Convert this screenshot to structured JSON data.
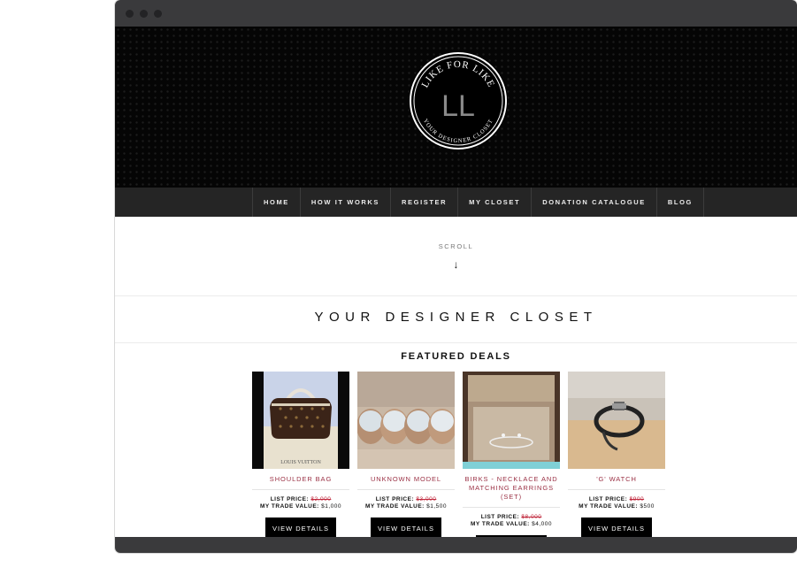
{
  "logo": {
    "top_text": "LIKE FOR LIKE",
    "bottom_text": "YOUR DESIGNER CLOSET",
    "monogram": "LL"
  },
  "nav": {
    "items": [
      {
        "label": "HOME"
      },
      {
        "label": "HOW IT WORKS"
      },
      {
        "label": "REGISTER"
      },
      {
        "label": "MY CLOSET"
      },
      {
        "label": "DONATION CATALOGUE"
      },
      {
        "label": "BLOG"
      }
    ]
  },
  "scroll": {
    "label": "SCROLL",
    "arrow": "↓"
  },
  "headline": "YOUR DESIGNER CLOSET",
  "featured": {
    "title": "FEATURED DEALS",
    "list_price_label": "LIST PRICE:",
    "trade_value_label": "MY TRADE VALUE:",
    "button_label": "VIEW DETAILS",
    "deals": [
      {
        "title": "SHOULDER BAG",
        "list_price": "$2,000",
        "trade_value": "$1,000",
        "image_caption": "LOUIS VUITTON"
      },
      {
        "title": "UNKNOWN MODEL",
        "list_price": "$3,000",
        "trade_value": "$1,500"
      },
      {
        "title": "BIRKS - NECKLACE AND MATCHING EARRINGS (SET)",
        "list_price": "$8,000",
        "trade_value": "$4,000"
      },
      {
        "title": "'G' WATCH",
        "list_price": "$900",
        "trade_value": "$500"
      }
    ]
  },
  "colors": {
    "accent_title": "#9a3044",
    "strike_price": "#c0283c",
    "nav_background": "#252525",
    "hero_background": "#050505",
    "button_background": "#000000"
  }
}
